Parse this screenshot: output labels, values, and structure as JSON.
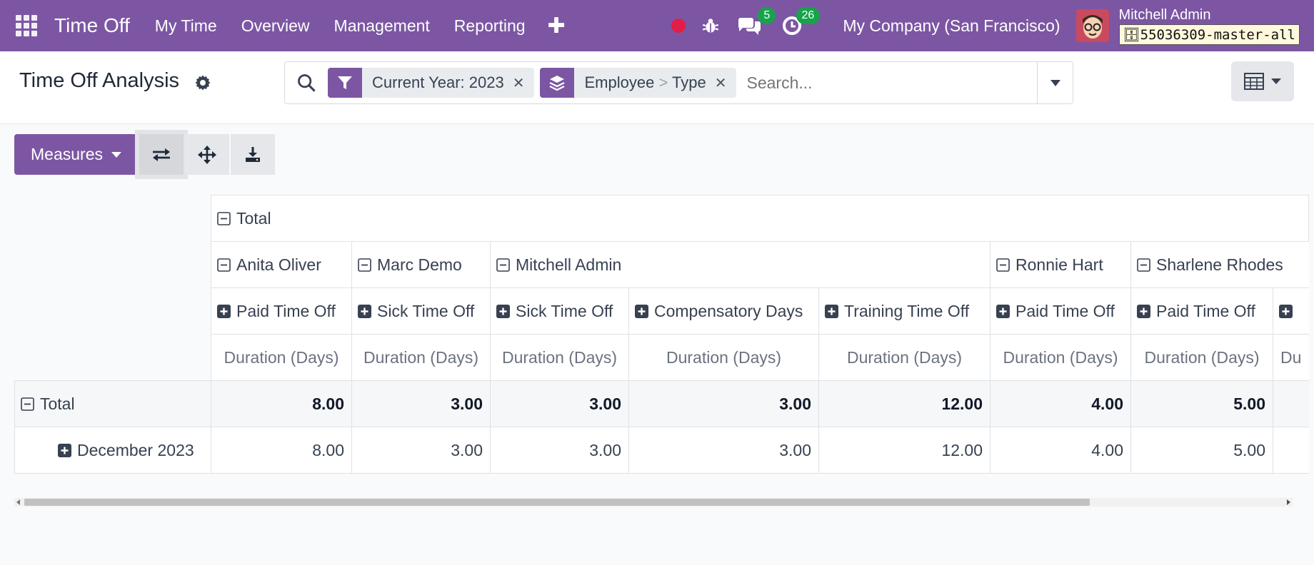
{
  "navbar": {
    "app_name": "Time Off",
    "menu": [
      "My Time",
      "Overview",
      "Management",
      "Reporting"
    ],
    "messages_count": "5",
    "activities_count": "26",
    "company": "My Company (San Francisco)",
    "user_name": "Mitchell Admin",
    "database": "55036309-master-all"
  },
  "control": {
    "title": "Time Off Analysis",
    "facets": [
      {
        "label": "Current Year: 2023"
      },
      {
        "part1": "Employee",
        "sep": ">",
        "part2": "Type"
      }
    ],
    "search_placeholder": "Search..."
  },
  "toolbar": {
    "measures_label": "Measures"
  },
  "pivot": {
    "col_total": "Total",
    "employees": [
      {
        "name": "Anita Oliver",
        "span": 1
      },
      {
        "name": "Marc Demo",
        "span": 1
      },
      {
        "name": "Mitchell Admin",
        "span": 3
      },
      {
        "name": "Ronnie Hart",
        "span": 1
      },
      {
        "name": "Sharlene Rhodes",
        "span": 1
      }
    ],
    "types": [
      "Paid Time Off",
      "Sick Time Off",
      "Sick Time Off",
      "Compensatory Days",
      "Training Time Off",
      "Paid Time Off",
      "Paid Time Off"
    ],
    "measure": "Duration (Days)",
    "measure_partial": "Du",
    "rows": [
      {
        "label": "Total",
        "values": [
          "8.00",
          "3.00",
          "3.00",
          "3.00",
          "12.00",
          "4.00",
          "5.00"
        ]
      },
      {
        "label": "December 2023",
        "values": [
          "8.00",
          "3.00",
          "3.00",
          "3.00",
          "12.00",
          "4.00",
          "5.00"
        ]
      }
    ]
  }
}
